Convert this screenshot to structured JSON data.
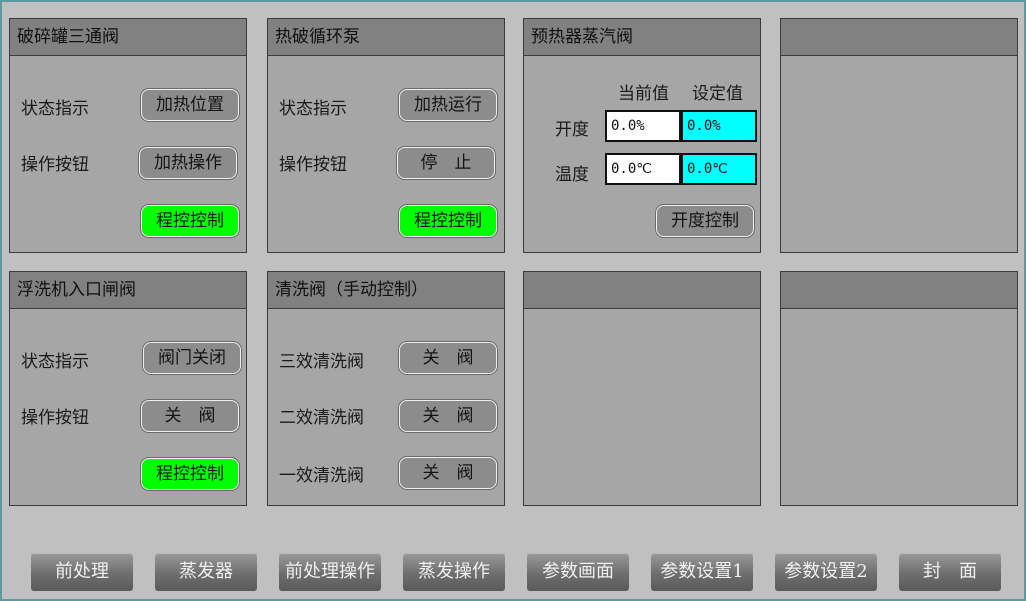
{
  "panels": {
    "crusher_valve": {
      "title": "破碎罐三通阀",
      "status_label": "状态指示",
      "status_value": "加热位置",
      "op_label": "操作按钮",
      "op_button": "加热操作",
      "mode_button": "程控控制"
    },
    "circ_pump": {
      "title": "热破循环泵",
      "status_label": "状态指示",
      "status_value": "加热运行",
      "op_label": "操作按钮",
      "op_button": "停　止",
      "mode_button": "程控控制"
    },
    "preheater": {
      "title": "预热器蒸汽阀",
      "col_current": "当前值",
      "col_setpoint": "设定值",
      "row_opening": "开度",
      "row_temp": "温度",
      "opening_current": "0.0%",
      "opening_setpoint": "0.0%",
      "temp_current": "0.0℃",
      "temp_setpoint": "0.0℃",
      "control_button": "开度控制"
    },
    "flotation_valve": {
      "title": "浮洗机入口闸阀",
      "status_label": "状态指示",
      "status_value": "阀门关闭",
      "op_label": "操作按钮",
      "op_button": "关　阀",
      "mode_button": "程控控制"
    },
    "wash_valves": {
      "title": "清洗阀（手动控制）",
      "rows": [
        {
          "label": "三效清洗阀",
          "button": "关　阀"
        },
        {
          "label": "二效清洗阀",
          "button": "关　阀"
        },
        {
          "label": "一效清洗阀",
          "button": "关　阀"
        }
      ]
    }
  },
  "nav": [
    "前处理",
    "蒸发器",
    "前处理操作",
    "蒸发操作",
    "参数画面",
    "参数设置1",
    "参数设置2",
    "封　面"
  ],
  "colors": {
    "active_green": "#00ff00",
    "setpoint_cyan": "#00ffff",
    "panel_gray": "#a6a6a6",
    "header_gray": "#818181"
  }
}
